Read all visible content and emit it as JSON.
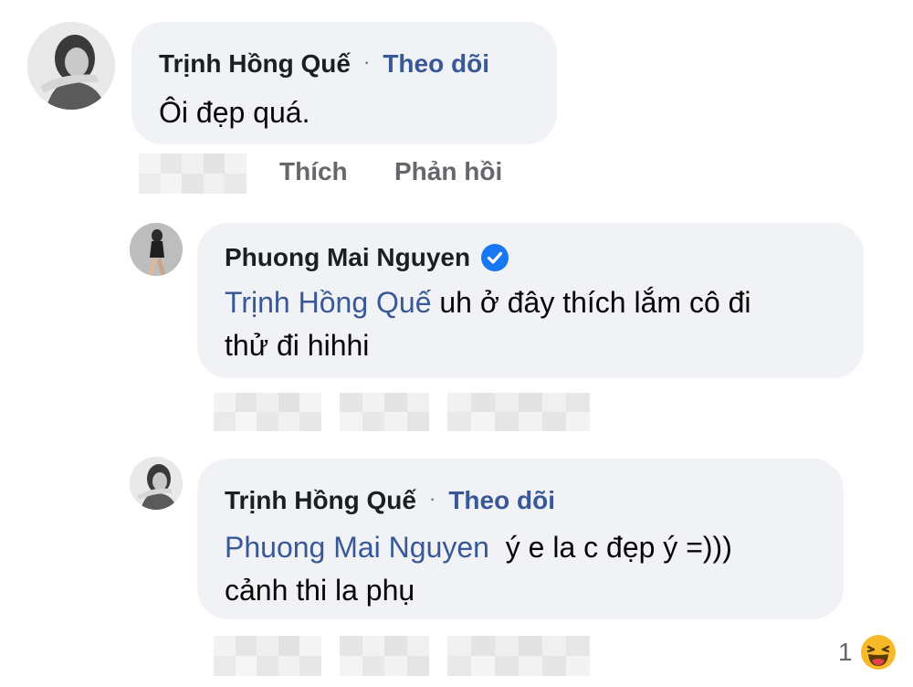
{
  "comments": [
    {
      "author": "Trịnh Hồng Quế",
      "separator": "·",
      "follow_label": "Theo dõi",
      "body": "Ôi đẹp quá.",
      "actions": {
        "like": "Thích",
        "reply": "Phản hồi"
      }
    },
    {
      "author": "Phuong Mai Nguyen",
      "verified_icon": "verified-badge-icon",
      "mention": "Trịnh Hồng Quế",
      "body_line1": " uh ở đây thích lắm cô đi",
      "body_line2": "thử đi hihhi"
    },
    {
      "author": "Trịnh Hồng Quế",
      "separator": "·",
      "follow_label": "Theo dõi",
      "mention": "Phuong Mai Nguyen",
      "body_line1": "  ý e la c đẹp ý =)))",
      "body_line2": "cảnh thi la phụ",
      "reaction_count": "1",
      "reaction_icon": "laughing-emoji-icon"
    }
  ],
  "colors": {
    "bubble": "#f0f2f5",
    "link": "#385898",
    "verified": "#1877f2",
    "muted": "#65676b"
  }
}
